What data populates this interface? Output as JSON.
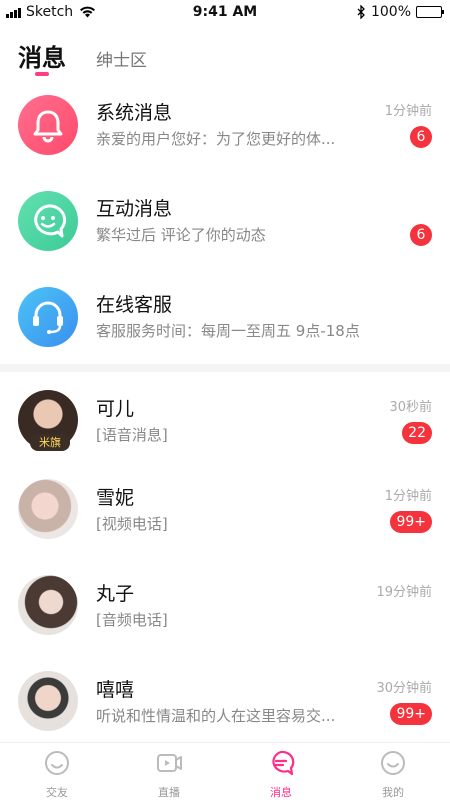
{
  "status_bar": {
    "carrier": "Sketch",
    "time": "9:41 AM",
    "battery": "100%",
    "battery_level": 1.0
  },
  "header": {
    "tabs": [
      {
        "label": "消息",
        "active": true
      },
      {
        "label": "绅士区",
        "active": false
      }
    ]
  },
  "system_messages": [
    {
      "title": "系统消息",
      "subtitle": "亲爱的用户您好：为了您更好的体...",
      "time": "1分钟前",
      "badge": "6",
      "icon": "bell-icon",
      "color": "#ff5f7e"
    },
    {
      "title": "互动消息",
      "subtitle": "繁华过后 评论了你的动态",
      "time": "",
      "badge": "6",
      "icon": "chat-smile-icon",
      "color": "#4fd6a7"
    },
    {
      "title": "在线客服",
      "subtitle": "客服服务时间：每周一至周五 9点-18点",
      "time": "",
      "badge": "",
      "icon": "headset-icon",
      "color": "#42a6f2"
    }
  ],
  "chats": [
    {
      "name": "可儿",
      "preview": "[语音消息]",
      "time": "30秒前",
      "badge": "22",
      "tag": "米旗"
    },
    {
      "name": "雪妮",
      "preview": "[视频电话]",
      "time": "1分钟前",
      "badge": "99+"
    },
    {
      "name": "丸子",
      "preview": "[音频电话]",
      "time": "19分钟前",
      "badge": ""
    },
    {
      "name": "嘻嘻",
      "preview": "听说和性情温和的人在这里容易交...",
      "time": "30分钟前",
      "badge": "99+"
    }
  ],
  "tabbar": {
    "items": [
      {
        "label": "交友",
        "icon": "friends-icon",
        "active": false
      },
      {
        "label": "直播",
        "icon": "live-video-icon",
        "active": false
      },
      {
        "label": "消息",
        "icon": "message-icon",
        "active": true
      },
      {
        "label": "我的",
        "icon": "profile-smile-icon",
        "active": false
      }
    ]
  },
  "colors": {
    "accent": "#ff3d87",
    "badge": "#f4333c"
  }
}
